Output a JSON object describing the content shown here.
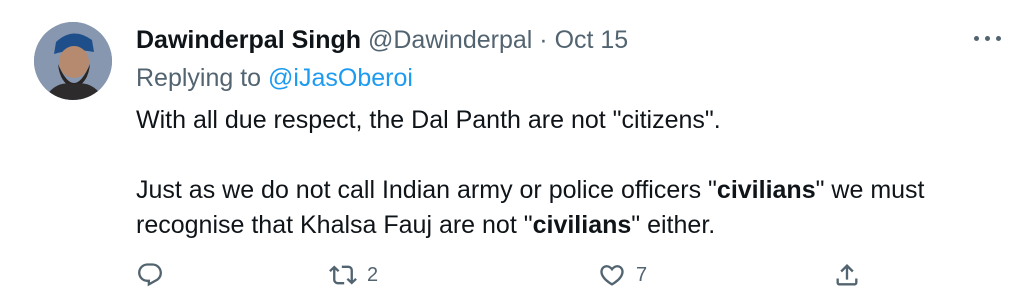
{
  "tweet": {
    "author_name": "Dawinderpal Singh",
    "handle": "@Dawinderpal",
    "separator": "·",
    "date": "Oct 15",
    "replying_prefix": "Replying to",
    "replying_to": "@iJasOberoi",
    "lines": {
      "l1": "With all due respect, the Dal Panth are not \"citizens\".",
      "l2a": "Just as we do not call Indian army or police officers \"",
      "l2b": "civilians",
      "l2c": "\" we must",
      "l3a": "recognise that Khalsa Fauj are not \"",
      "l3b": "civilians",
      "l3c": "\" either."
    },
    "actions": {
      "reply_count": "",
      "retweet_count": "2",
      "like_count": "7"
    }
  },
  "icons": [
    "avatar",
    "more-icon",
    "reply-icon",
    "retweet-icon",
    "like-icon",
    "share-icon"
  ],
  "colors": {
    "text": "#0f1419",
    "secondary": "#536471",
    "link": "#1d9bf0"
  }
}
